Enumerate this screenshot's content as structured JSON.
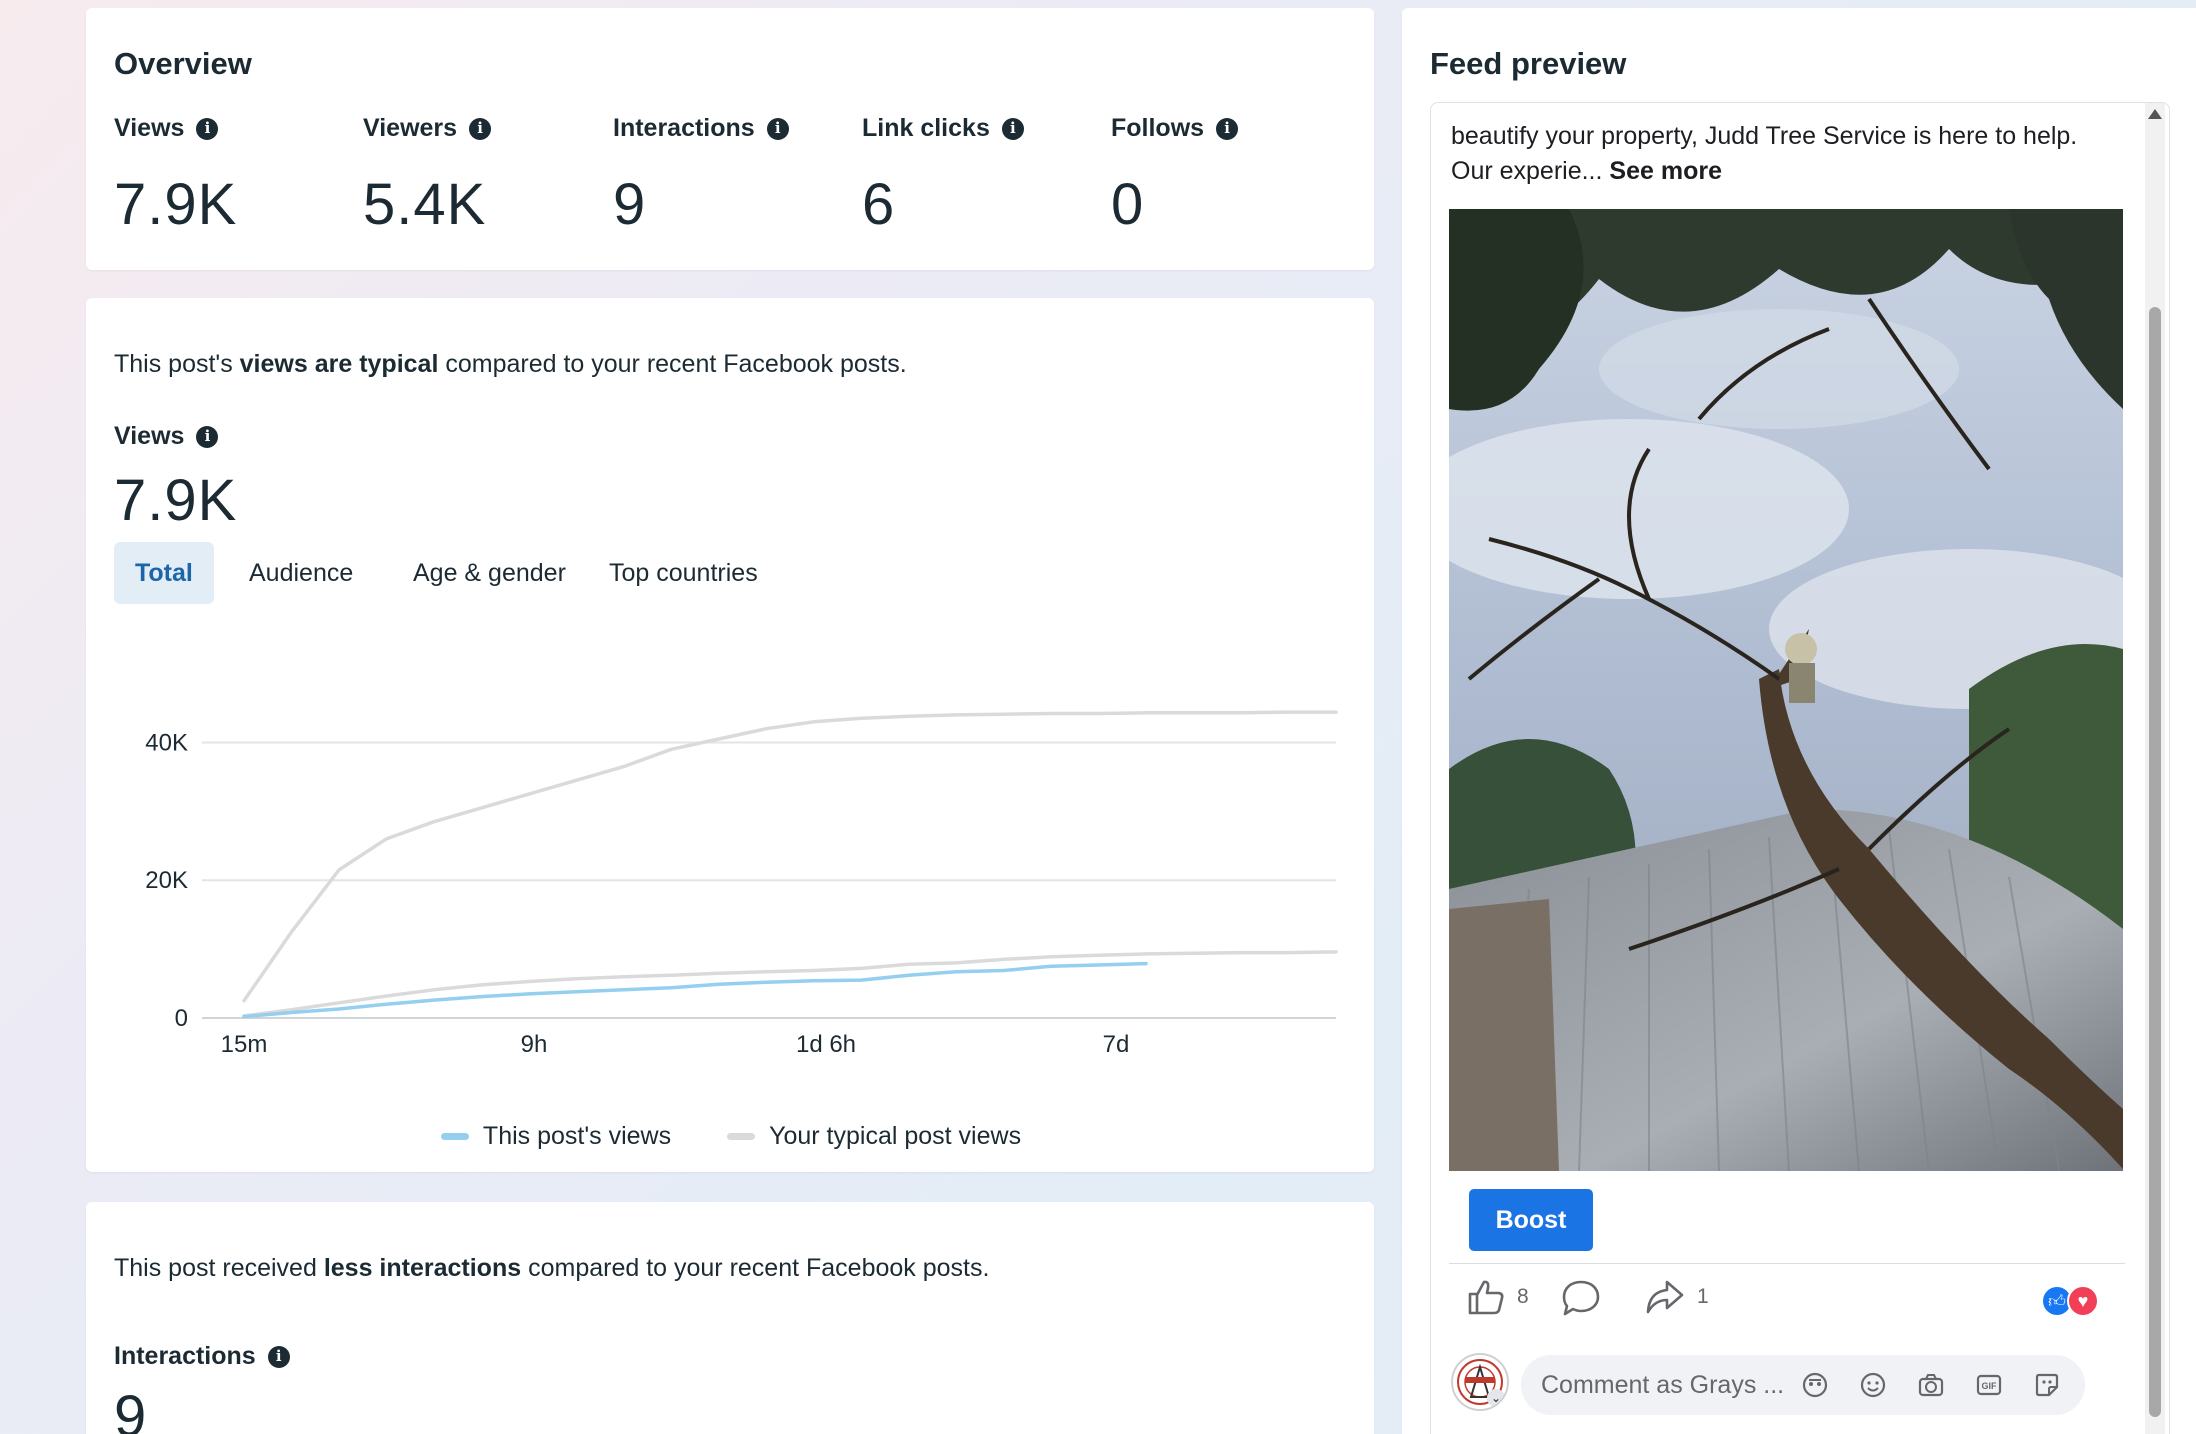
{
  "overview": {
    "title": "Overview",
    "metrics": [
      {
        "label": "Views",
        "value": "7.9K"
      },
      {
        "label": "Viewers",
        "value": "5.4K"
      },
      {
        "label": "Interactions",
        "value": "9"
      },
      {
        "label": "Link clicks",
        "value": "6"
      },
      {
        "label": "Follows",
        "value": "0"
      }
    ]
  },
  "views_card": {
    "sentence_pre": "This post's ",
    "sentence_bold": "views are typical",
    "sentence_post": " compared to your recent Facebook posts.",
    "metric_label": "Views",
    "metric_value": "7.9K",
    "tabs": [
      {
        "label": "Total",
        "active": true
      },
      {
        "label": "Audience",
        "active": false
      },
      {
        "label": "Age & gender",
        "active": false
      },
      {
        "label": "Top countries",
        "active": false
      }
    ]
  },
  "chart_data": {
    "type": "line",
    "y_ticks": [
      "40K",
      "20K",
      "0"
    ],
    "x_ticks": [
      "15m",
      "9h",
      "1d 6h",
      "7d"
    ],
    "ylim": [
      0,
      45000
    ],
    "grid": true,
    "legend_position": "bottom",
    "x": [
      0,
      0.5,
      1,
      1.5,
      2,
      2.5,
      3,
      3.5,
      4,
      4.5,
      5,
      5.5,
      6,
      6.5,
      7,
      7.5,
      8,
      8.5,
      9,
      9.5,
      10,
      10.5,
      11,
      11.5
    ],
    "series": [
      {
        "name": "This post's views",
        "color": "#94cfef",
        "values": [
          200,
          800,
          1300,
          2000,
          2600,
          3100,
          3500,
          3800,
          4100,
          4400,
          4900,
          5200,
          5400,
          5500,
          6200,
          6700,
          6900,
          7500,
          7700,
          7900
        ]
      },
      {
        "name": "Your typical post views",
        "color": "#dadada",
        "values": [
          300,
          1200,
          2200,
          3200,
          4100,
          4800,
          5300,
          5700,
          6000,
          6200,
          6500,
          6700,
          6900,
          7200,
          7800,
          8000,
          8500,
          8900,
          9100,
          9300,
          9400,
          9500,
          9500,
          9600
        ]
      },
      {
        "name": "Your typical post views (upper range)",
        "color": "#dadada",
        "values": [
          2500,
          12500,
          21500,
          26000,
          28500,
          30500,
          32500,
          34500,
          36500,
          39000,
          40500,
          42000,
          43000,
          43500,
          43800,
          44000,
          44100,
          44200,
          44200,
          44300,
          44300,
          44300,
          44400,
          44400
        ]
      }
    ]
  },
  "interactions_card": {
    "sentence_pre": "This post received ",
    "sentence_bold": "less interactions",
    "sentence_post": " compared to your recent Facebook posts.",
    "metric_label": "Interactions",
    "metric_value": "9"
  },
  "feed_preview": {
    "title": "Feed preview",
    "post_text": "beautify your property, Judd Tree Service is here to help.  Our experie...",
    "see_more": "See more",
    "boost_label": "Boost",
    "like_count": "8",
    "share_count": "1",
    "comment_placeholder": "Comment as Grays ...",
    "icons": [
      "like-icon",
      "comment-icon",
      "share-icon",
      "like-reaction-icon",
      "love-reaction-icon",
      "avatar-icon",
      "avatar-icon",
      "emoji-icon",
      "camera-icon",
      "gif-icon",
      "sticker-icon"
    ],
    "colors": {
      "boost": "#1b74e4",
      "like_reaction": "#1877f2",
      "love_reaction": "#f33e58"
    }
  },
  "colors": {
    "accent": "#1d64a9",
    "this_post_line": "#94cfef",
    "typical_line": "#dadada"
  }
}
